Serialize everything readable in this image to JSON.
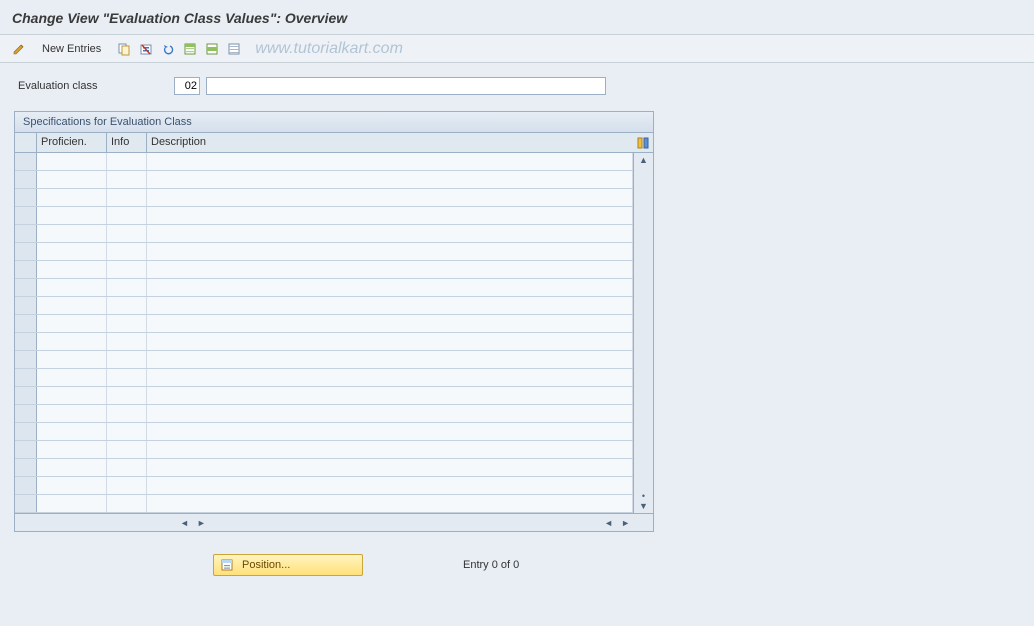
{
  "title": "Change View \"Evaluation Class Values\": Overview",
  "toolbar": {
    "new_entries_label": "New Entries",
    "icons": {
      "display_change": "display-change",
      "copy": "copy",
      "delete": "delete",
      "undo": "undo",
      "select_all": "select-all",
      "select_block": "select-block",
      "deselect": "deselect"
    }
  },
  "watermark": "www.tutorialkart.com",
  "field": {
    "label": "Evaluation class",
    "code": "02",
    "description": ""
  },
  "panel": {
    "title": "Specifications for Evaluation Class",
    "columns": {
      "proficien": "Proficien.",
      "info": "Info",
      "description": "Description"
    }
  },
  "footer": {
    "position_label": "Position...",
    "entry_text": "Entry 0 of 0"
  }
}
